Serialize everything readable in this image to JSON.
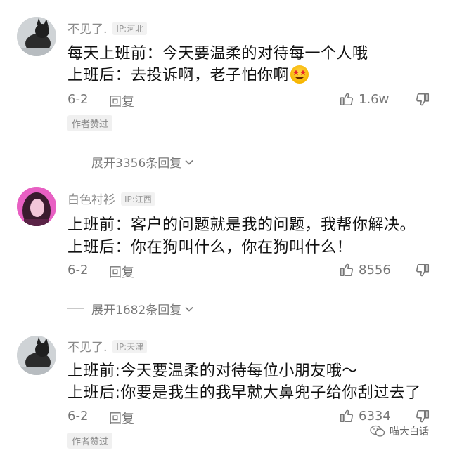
{
  "comments": [
    {
      "username": "不见了.",
      "ip": "IP:河北",
      "lines": [
        "每天上班前：今天要温柔的对待每一个人哦",
        "上班后：去投诉啊，老子怕你啊"
      ],
      "date": "6-2",
      "reply_label": "回复",
      "likes": "1.6w",
      "author_liked": "作者赞过",
      "expand_label": "展开3356条回复"
    },
    {
      "username": "白色衬衫",
      "ip": "IP:江西",
      "lines": [
        "上班前：客户的问题就是我的问题，我帮你解决。",
        "上班后：你在狗叫什么，你在狗叫什么！"
      ],
      "date": "6-2",
      "reply_label": "回复",
      "likes": "8556",
      "expand_label": "展开1682条回复"
    },
    {
      "username": "不见了.",
      "ip": "IP:天津",
      "lines": [
        "上班前:今天要温柔的对待每位小朋友哦～",
        "上班后:你要是我生的我早就大鼻兜子给你刮过去了"
      ],
      "date": "6-2",
      "reply_label": "回复",
      "likes": "6334",
      "author_liked": "作者赞过"
    }
  ],
  "watermark": "喵大白话",
  "icons": {
    "like": "thumbs-up-icon",
    "dislike": "thumbs-down-icon",
    "expand": "chevron-down-icon",
    "emoji": "star-struck-emoji-icon",
    "watermark": "wechat-icon"
  }
}
